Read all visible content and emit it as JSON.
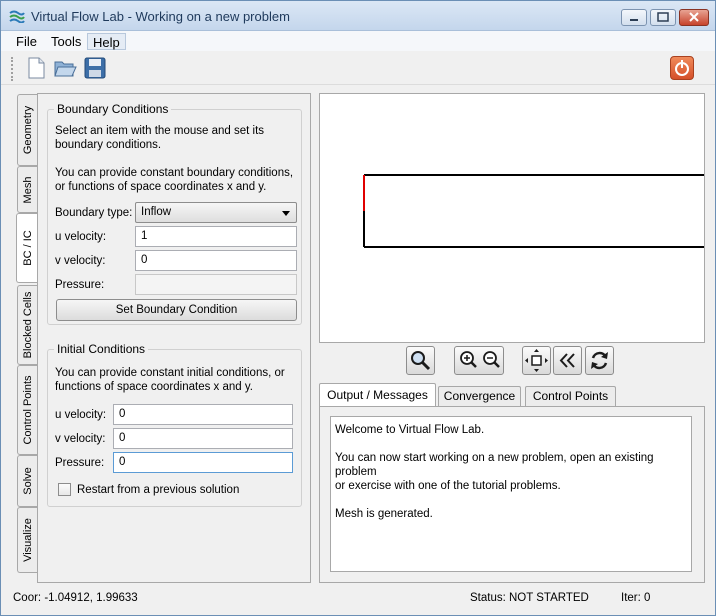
{
  "window": {
    "title": "Virtual Flow Lab - Working on a new problem",
    "accent": "#1e395b"
  },
  "menu": {
    "items": [
      "File",
      "Tools",
      "Help"
    ]
  },
  "toolbar": {
    "icons": [
      "new-file-icon",
      "open-folder-icon",
      "save-disk-icon",
      "power-icon"
    ]
  },
  "side_tabs": [
    "Geometry",
    "Mesh",
    "BC / IC",
    "Blocked Cells",
    "Control Points",
    "Solve",
    "Visualize"
  ],
  "boundary": {
    "title": "Boundary Conditions",
    "help1": "Select an item with the mouse and set its boundary conditions.",
    "help2": "You can provide constant boundary conditions, or functions of space coordinates x and y.",
    "type_label": "Boundary type:",
    "type_value": "Inflow",
    "u_label": "u velocity:",
    "u_value": "1",
    "v_label": "v velocity:",
    "v_value": "0",
    "p_label": "Pressure:",
    "p_value": "",
    "set_button": "Set Boundary Condition"
  },
  "initial": {
    "title": "Initial Conditions",
    "help": "You can provide constant initial conditions, or functions of space coordinates x and y.",
    "u_label": "u velocity:",
    "u_value": "0",
    "v_label": "v velocity:",
    "v_value": "0",
    "p_label": "Pressure:",
    "p_value": "0",
    "restart_label": "Restart from a previous solution"
  },
  "view_controls": [
    "zoom-icon",
    "zoom-in-icon",
    "zoom-out-icon",
    "pan-icon",
    "rewind-icon",
    "refresh-icon"
  ],
  "output_tabs": [
    "Output / Messages",
    "Convergence",
    "Control Points"
  ],
  "output": {
    "text": "Welcome to Virtual Flow Lab.\n\nYou can now start working on a new problem, open an existing problem\nor exercise with one of the tutorial problems.\n\nMesh is generated."
  },
  "status": {
    "coor": "Coor: -1.04912, 1.99633",
    "state": "Status: NOT STARTED",
    "iter": "Iter: 0"
  },
  "colors": {
    "boundary_highlight": "#e00000",
    "geometry_line": "#000000"
  }
}
